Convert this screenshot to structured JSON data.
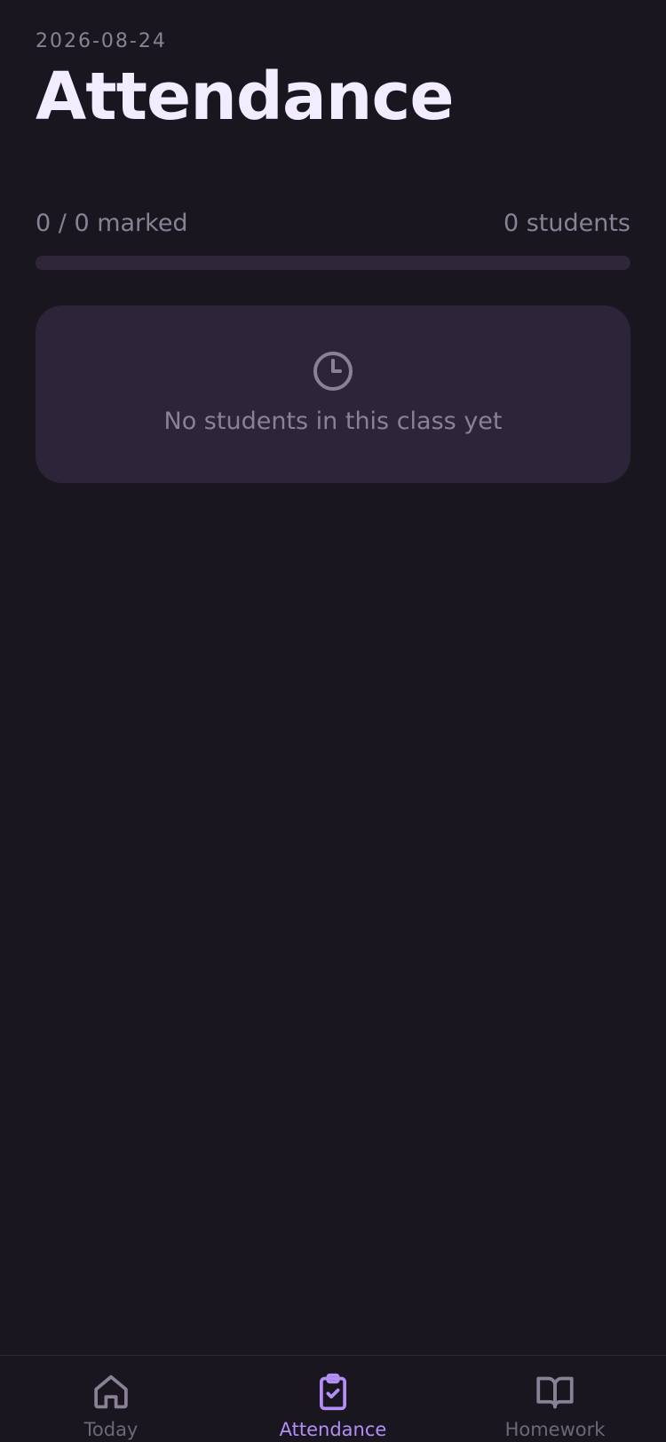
{
  "header": {
    "date": "2026-08-24",
    "title": "Attendance"
  },
  "summary": {
    "marked_text": "0 / 0 marked",
    "students_text": "0 students",
    "progress_fraction": 0
  },
  "empty_state": {
    "icon": "clock-icon",
    "message": "No students in this class yet"
  },
  "tabs": [
    {
      "label": "Today",
      "icon": "home-icon",
      "active": false
    },
    {
      "label": "Attendance",
      "icon": "clipboard-check-icon",
      "active": true
    },
    {
      "label": "Homework",
      "icon": "book-open-icon",
      "active": false
    }
  ],
  "colors": {
    "background": "#19161f",
    "card": "#2c2438",
    "accent": "#b28ef5",
    "muted_text": "#8a8196",
    "title_text": "#f1ecff"
  }
}
